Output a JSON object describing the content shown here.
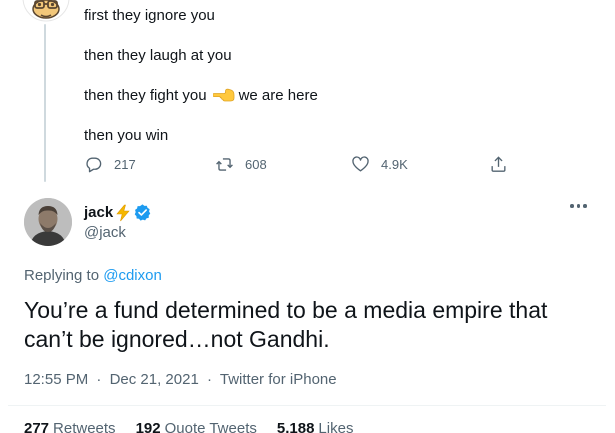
{
  "parent": {
    "lines": [
      "first they ignore you",
      "then they laugh at you",
      "then they fight you",
      "then you win"
    ],
    "pointer_emoji_name": "backhand-index-pointing-left",
    "pointer_suffix": "we are here",
    "actions": {
      "reply_count": "217",
      "retweet_count": "608",
      "like_count": "4.9K"
    }
  },
  "reply": {
    "display_name": "jack",
    "name_emoji": "lightning-bolt",
    "verified": true,
    "handle": "@jack",
    "replying_prefix": "Replying to",
    "replying_to": "@cdixon",
    "text": "You’re a fund determined to be a media empire that can’t be ignored…not Gandhi.",
    "time": "12:55 PM",
    "date": "Dec 21, 2021",
    "source": "Twitter for iPhone",
    "separator": "·"
  },
  "stats": [
    {
      "count": "277",
      "label": "Retweets"
    },
    {
      "count": "192",
      "label": "Quote Tweets"
    },
    {
      "count": "5,188",
      "label": "Likes"
    }
  ],
  "colors": {
    "text": "#0f1419",
    "secondary": "#536471",
    "link": "#1d9bf0",
    "verified": "#1d9bf0",
    "bolt": "#f5b800"
  }
}
